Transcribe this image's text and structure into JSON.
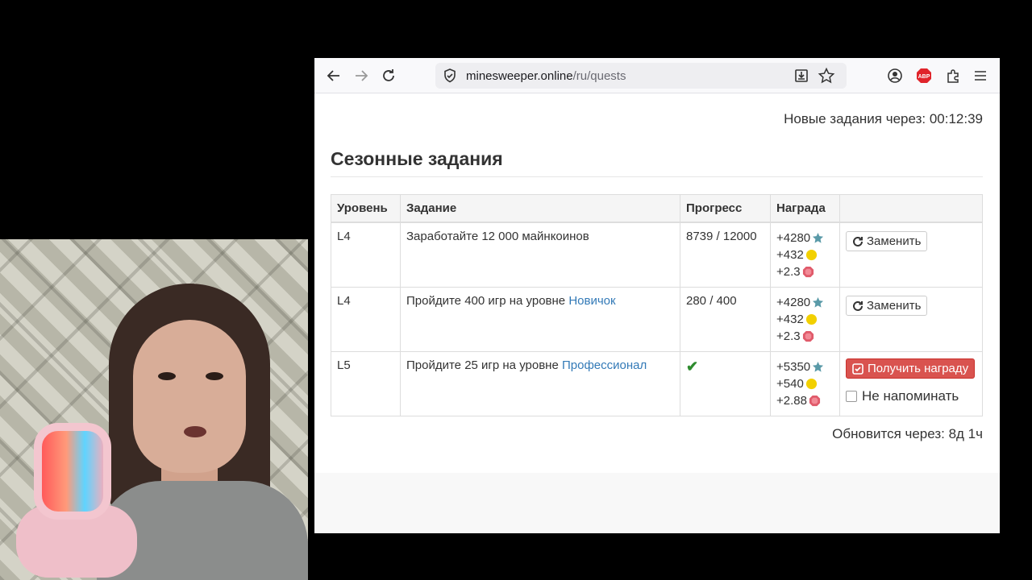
{
  "browser": {
    "url_host": "minesweeper.online",
    "url_path": "/ru/quests"
  },
  "page": {
    "new_quests_text": "Новые задания через: 00:12:39",
    "section_title": "Сезонные задания",
    "refresh_text": "Обновится через: 8д 1ч"
  },
  "table": {
    "headers": [
      "Уровень",
      "Задание",
      "Прогресс",
      "Награда",
      ""
    ],
    "rows": [
      {
        "level": "L4",
        "task": "Заработайте 12 000 майнкоинов",
        "task_link": "",
        "progress": "8739 / 12000",
        "reward_xp": "+4280",
        "reward_coins": "+432",
        "reward_gems": "+2.3",
        "action": "Заменить"
      },
      {
        "level": "L4",
        "task": "Пройдите 400 игр на уровне ",
        "task_link": "Новичок",
        "progress": "280 / 400",
        "reward_xp": "+4280",
        "reward_coins": "+432",
        "reward_gems": "+2.3",
        "action": "Заменить"
      },
      {
        "level": "L5",
        "task": "Пройдите 25 игр на уровне ",
        "task_link": "Профессионал",
        "progress": "✔",
        "reward_xp": "+5350",
        "reward_coins": "+540",
        "reward_gems": "+2.88",
        "action": "Получить награду",
        "remind_label": "Не напоминать"
      }
    ]
  },
  "icons": {
    "xp": "star-icon",
    "coins": "coin-icon",
    "gems": "gem-icon",
    "replace": "refresh-icon",
    "claim": "check-square-icon"
  },
  "colors": {
    "link": "#337ab7",
    "claim_button": "#d9534f",
    "star": "#5a9aa8",
    "coin": "#f2d000",
    "gem": "#e05a6a"
  }
}
